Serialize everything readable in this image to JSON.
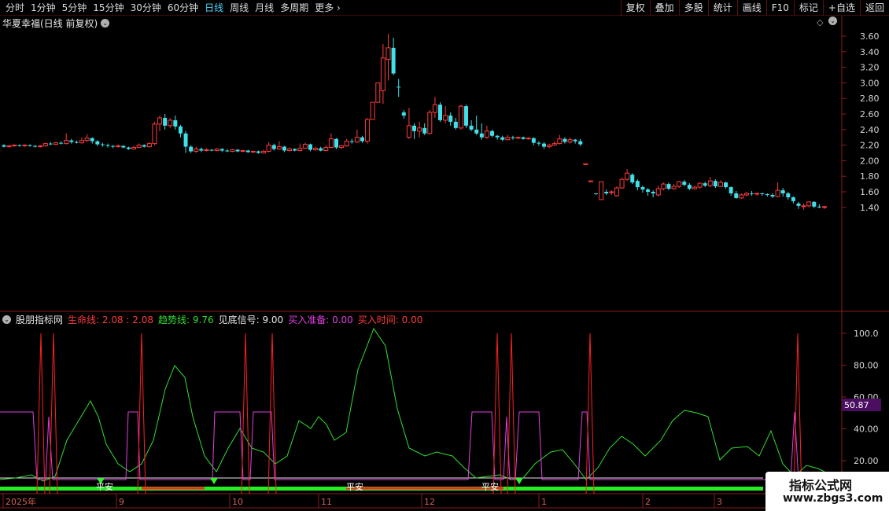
{
  "toolbar": {
    "period_tabs": [
      "分时",
      "1分钟",
      "5分钟",
      "15分钟",
      "30分钟",
      "60分钟",
      "日线",
      "周线",
      "月线",
      "多周期",
      "更多"
    ],
    "active_tab": "日线",
    "right_tools": [
      "复权",
      "叠加",
      "多股",
      "统计",
      "画线",
      "F10",
      "标记",
      "+自选",
      "返回"
    ]
  },
  "stock": {
    "title": "华夏幸福(日线 前复权)"
  },
  "main_axis": {
    "ticks": [
      "3.60",
      "3.40",
      "3.20",
      "3.00",
      "2.80",
      "2.60",
      "2.40",
      "2.20",
      "2.00",
      "1.80",
      "1.60",
      "1.40"
    ]
  },
  "indicator": {
    "name": "股朋指标网",
    "life_label": "生命线",
    "life_values": "2.08 : 2.08",
    "trend_label": "趋势线",
    "trend_value": "9.76",
    "bottom_label": "见底信号",
    "bottom_value": "9.00",
    "buy_ready_label": "买入准备",
    "buy_ready_value": "0.00",
    "buy_time_label": "买入时间",
    "buy_time_value": "0.00",
    "axis_ticks": [
      "100.0",
      "80.00",
      "60.00",
      "40.00",
      "20.00"
    ],
    "current_marker": "50.87",
    "signal_text": "平安"
  },
  "date_axis": {
    "labels": [
      "2025年",
      "9",
      "10",
      "11",
      "12",
      "1",
      "2",
      "3"
    ]
  },
  "watermark": {
    "line1": "指标公式网",
    "line2": "www.zbgs3.com"
  },
  "colors": {
    "up": "#ff3b3b",
    "down": "#3fe0ea",
    "trend_line": "#33dd33",
    "magenta": "#e040e0",
    "active_tab": "#4fd7ff",
    "axis_red": "#8a1a1a"
  },
  "chart_data": {
    "type": "candlestick",
    "price_range": [
      1.35,
      3.65
    ],
    "candles": [
      [
        2.2,
        2.18,
        2.21,
        2.17
      ],
      [
        2.18,
        2.19,
        2.2,
        2.17
      ],
      [
        2.19,
        2.2,
        2.21,
        2.18
      ],
      [
        2.2,
        2.19,
        2.21,
        2.18
      ],
      [
        2.19,
        2.2,
        2.21,
        2.18
      ],
      [
        2.2,
        2.19,
        2.21,
        2.18
      ],
      [
        2.19,
        2.18,
        2.2,
        2.17
      ],
      [
        2.18,
        2.19,
        2.2,
        2.17
      ],
      [
        2.19,
        2.22,
        2.23,
        2.18
      ],
      [
        2.22,
        2.21,
        2.24,
        2.2
      ],
      [
        2.21,
        2.23,
        2.24,
        2.2
      ],
      [
        2.23,
        2.22,
        2.25,
        2.21
      ],
      [
        2.22,
        2.26,
        2.35,
        2.21
      ],
      [
        2.26,
        2.24,
        2.28,
        2.22
      ],
      [
        2.24,
        2.23,
        2.26,
        2.22
      ],
      [
        2.23,
        2.26,
        2.3,
        2.22
      ],
      [
        2.26,
        2.29,
        2.34,
        2.24
      ],
      [
        2.29,
        2.25,
        2.3,
        2.22
      ],
      [
        2.25,
        2.21,
        2.26,
        2.19
      ],
      [
        2.21,
        2.2,
        2.23,
        2.18
      ],
      [
        2.2,
        2.19,
        2.22,
        2.17
      ],
      [
        2.19,
        2.18,
        2.2,
        2.16
      ],
      [
        2.18,
        2.19,
        2.21,
        2.17
      ],
      [
        2.19,
        2.17,
        2.2,
        2.16
      ],
      [
        2.17,
        2.15,
        2.18,
        2.14
      ],
      [
        2.15,
        2.17,
        2.19,
        2.14
      ],
      [
        2.17,
        2.2,
        2.22,
        2.16
      ],
      [
        2.2,
        2.18,
        2.21,
        2.17
      ],
      [
        2.18,
        2.22,
        2.24,
        2.17
      ],
      [
        2.22,
        2.47,
        2.5,
        2.2
      ],
      [
        2.47,
        2.55,
        2.58,
        2.38
      ],
      [
        2.55,
        2.45,
        2.6,
        2.4
      ],
      [
        2.45,
        2.52,
        2.55,
        2.42
      ],
      [
        2.52,
        2.44,
        2.58,
        2.4
      ],
      [
        2.44,
        2.35,
        2.46,
        2.3
      ],
      [
        2.35,
        2.18,
        2.38,
        2.1
      ],
      [
        2.18,
        2.12,
        2.2,
        2.1
      ],
      [
        2.12,
        2.15,
        2.18,
        2.1
      ],
      [
        2.15,
        2.13,
        2.17,
        2.11
      ],
      [
        2.13,
        2.14,
        2.16,
        2.12
      ],
      [
        2.14,
        2.13,
        2.15,
        2.12
      ],
      [
        2.13,
        2.15,
        2.16,
        2.12
      ],
      [
        2.15,
        2.13,
        2.16,
        2.11
      ],
      [
        2.13,
        2.12,
        2.15,
        2.11
      ],
      [
        2.12,
        2.14,
        2.15,
        2.11
      ],
      [
        2.14,
        2.12,
        2.15,
        2.11
      ],
      [
        2.12,
        2.13,
        2.14,
        2.11
      ],
      [
        2.13,
        2.11,
        2.14,
        2.1
      ],
      [
        2.11,
        2.12,
        2.13,
        2.1
      ],
      [
        2.12,
        2.1,
        2.13,
        2.09
      ],
      [
        2.1,
        2.12,
        2.14,
        2.09
      ],
      [
        2.12,
        2.2,
        2.24,
        2.11
      ],
      [
        2.2,
        2.15,
        2.22,
        2.13
      ],
      [
        2.15,
        2.18,
        2.25,
        2.14
      ],
      [
        2.18,
        2.13,
        2.19,
        2.11
      ],
      [
        2.13,
        2.15,
        2.17,
        2.12
      ],
      [
        2.15,
        2.13,
        2.16,
        2.12
      ],
      [
        2.13,
        2.16,
        2.22,
        2.12
      ],
      [
        2.16,
        2.21,
        2.23,
        2.15
      ],
      [
        2.21,
        2.14,
        2.22,
        2.12
      ],
      [
        2.14,
        2.16,
        2.18,
        2.13
      ],
      [
        2.16,
        2.13,
        2.18,
        2.12
      ],
      [
        2.13,
        2.17,
        2.2,
        2.12
      ],
      [
        2.17,
        2.28,
        2.35,
        2.16
      ],
      [
        2.28,
        2.17,
        2.29,
        2.15
      ],
      [
        2.17,
        2.19,
        2.2,
        2.15
      ],
      [
        2.19,
        2.25,
        2.28,
        2.18
      ],
      [
        2.25,
        2.24,
        2.28,
        2.22
      ],
      [
        2.24,
        2.3,
        2.4,
        2.23
      ],
      [
        2.3,
        2.25,
        2.32,
        2.23
      ],
      [
        2.25,
        2.53,
        2.55,
        2.22
      ],
      [
        2.53,
        2.75,
        2.75,
        2.75
      ],
      [
        2.75,
        3.0,
        3.0,
        3.0
      ],
      [
        2.9,
        3.32,
        3.5,
        2.73
      ],
      [
        3.3,
        3.45,
        3.63,
        3.03
      ],
      [
        3.45,
        3.12,
        3.58,
        3.1
      ],
      [
        2.95,
        2.94,
        3.05,
        2.82
      ],
      [
        2.62,
        2.58,
        2.65,
        2.54
      ],
      [
        2.3,
        2.45,
        2.68,
        2.28
      ],
      [
        2.45,
        2.38,
        2.48,
        2.28
      ],
      [
        2.38,
        2.42,
        2.5,
        2.3
      ],
      [
        2.42,
        2.35,
        2.48,
        2.33
      ],
      [
        2.35,
        2.62,
        2.65,
        2.34
      ],
      [
        2.62,
        2.72,
        2.82,
        2.55
      ],
      [
        2.72,
        2.52,
        2.75,
        2.5
      ],
      [
        2.52,
        2.58,
        2.7,
        2.48
      ],
      [
        2.58,
        2.5,
        2.62,
        2.45
      ],
      [
        2.5,
        2.42,
        2.55,
        2.4
      ],
      [
        2.42,
        2.7,
        2.72,
        2.4
      ],
      [
        2.7,
        2.45,
        2.72,
        2.42
      ],
      [
        2.45,
        2.4,
        2.52,
        2.38
      ],
      [
        2.4,
        2.35,
        2.58,
        2.33
      ],
      [
        2.35,
        2.3,
        2.48,
        2.27
      ],
      [
        2.3,
        2.38,
        2.45,
        2.28
      ],
      [
        2.38,
        2.32,
        2.4,
        2.3
      ],
      [
        2.32,
        2.3,
        2.33,
        2.27
      ],
      [
        2.3,
        2.27,
        2.32,
        2.25
      ],
      [
        2.27,
        2.3,
        2.33,
        2.26
      ],
      [
        2.3,
        2.29,
        2.32,
        2.27
      ],
      [
        2.29,
        2.3,
        2.31,
        2.28
      ],
      [
        2.3,
        2.28,
        2.31,
        2.27
      ],
      [
        2.28,
        2.29,
        2.3,
        2.27
      ],
      [
        2.29,
        2.23,
        2.3,
        2.2
      ],
      [
        2.23,
        2.22,
        2.25,
        2.19
      ],
      [
        2.22,
        2.18,
        2.24,
        2.15
      ],
      [
        2.18,
        2.2,
        2.22,
        2.16
      ],
      [
        2.2,
        2.22,
        2.25,
        2.19
      ],
      [
        2.22,
        2.28,
        2.33,
        2.21
      ],
      [
        2.28,
        2.24,
        2.3,
        2.22
      ],
      [
        2.24,
        2.27,
        2.3,
        2.22
      ],
      [
        2.27,
        2.25,
        2.28,
        2.22
      ],
      [
        2.25,
        2.21,
        2.28,
        2.19
      ],
      [
        1.96,
        1.96,
        1.96,
        1.96
      ],
      [
        1.74,
        1.74,
        1.74,
        1.74
      ],
      [
        1.58,
        1.57,
        1.58,
        1.56
      ],
      [
        1.5,
        1.73,
        1.73,
        1.5
      ],
      [
        1.6,
        1.58,
        1.63,
        1.56
      ],
      [
        1.6,
        1.6,
        1.62,
        1.56
      ],
      [
        1.55,
        1.65,
        1.67,
        1.54
      ],
      [
        1.65,
        1.76,
        1.78,
        1.64
      ],
      [
        1.76,
        1.84,
        1.89,
        1.74
      ],
      [
        1.82,
        1.72,
        1.84,
        1.7
      ],
      [
        1.74,
        1.66,
        1.76,
        1.62
      ],
      [
        1.66,
        1.63,
        1.68,
        1.59
      ],
      [
        1.63,
        1.6,
        1.65,
        1.55
      ],
      [
        1.6,
        1.58,
        1.62,
        1.53
      ],
      [
        1.56,
        1.64,
        1.68,
        1.54
      ],
      [
        1.64,
        1.7,
        1.72,
        1.62
      ],
      [
        1.7,
        1.64,
        1.72,
        1.62
      ],
      [
        1.64,
        1.67,
        1.7,
        1.63
      ],
      [
        1.67,
        1.73,
        1.74,
        1.65
      ],
      [
        1.73,
        1.69,
        1.75,
        1.67
      ],
      [
        1.69,
        1.64,
        1.71,
        1.62
      ],
      [
        1.64,
        1.66,
        1.68,
        1.63
      ],
      [
        1.66,
        1.71,
        1.72,
        1.64
      ],
      [
        1.71,
        1.68,
        1.73,
        1.66
      ],
      [
        1.68,
        1.74,
        1.79,
        1.66
      ],
      [
        1.74,
        1.67,
        1.76,
        1.65
      ],
      [
        1.67,
        1.72,
        1.75,
        1.66
      ],
      [
        1.72,
        1.66,
        1.73,
        1.64
      ],
      [
        1.66,
        1.58,
        1.67,
        1.55
      ],
      [
        1.58,
        1.52,
        1.61,
        1.51
      ],
      [
        1.52,
        1.56,
        1.58,
        1.51
      ],
      [
        1.56,
        1.58,
        1.6,
        1.54
      ],
      [
        1.58,
        1.57,
        1.61,
        1.55
      ],
      [
        1.57,
        1.58,
        1.59,
        1.55
      ],
      [
        1.58,
        1.57,
        1.59,
        1.55
      ],
      [
        1.57,
        1.56,
        1.58,
        1.54
      ],
      [
        1.56,
        1.54,
        1.58,
        1.52
      ],
      [
        1.54,
        1.62,
        1.72,
        1.53
      ],
      [
        1.62,
        1.58,
        1.65,
        1.54
      ],
      [
        1.58,
        1.53,
        1.6,
        1.5
      ],
      [
        1.53,
        1.48,
        1.54,
        1.45
      ],
      [
        1.45,
        1.42,
        1.47,
        1.38
      ],
      [
        1.42,
        1.42,
        1.45,
        1.37
      ],
      [
        1.42,
        1.47,
        1.48,
        1.4
      ],
      [
        1.47,
        1.41,
        1.48,
        1.39
      ],
      [
        1.41,
        1.4,
        1.44,
        1.39
      ],
      [
        1.4,
        1.41,
        1.42,
        1.38
      ]
    ]
  }
}
